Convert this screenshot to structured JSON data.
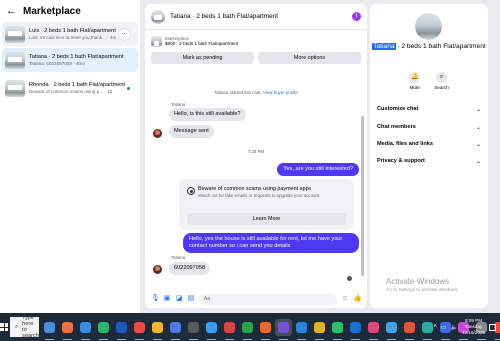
{
  "left_panel": {
    "back_icon": "arrow-left-icon",
    "title": "Marketplace",
    "conversations": [
      {
        "name": "Luis · 2 beds 1 bath Flat/apartment",
        "preview": "Luis: Im cuis nice to meet you thank... · 4m",
        "more_label": "…"
      },
      {
        "name": "Tatiana · 2 beds 1 bath Flat/apartment",
        "preview": "Tatiana: 6022097058 · 40m"
      },
      {
        "name": "Rhonda · 2 beds 1 bath Flat/apartment",
        "preview": "Beware of common scams using p... · 1d"
      }
    ]
  },
  "chat": {
    "title": "Tatiana · 2 beds 1 bath Flat/apartment",
    "info_icon": "i",
    "listing_label": "Marketplace",
    "listing_detail": "$800 · 2 beds 1 bath Flat/apartment",
    "mark_pending": "Mark as pending",
    "more_options": "More options",
    "started_text": "Tatiana started this chat.",
    "view_profile": "View buyer profile",
    "sender_name_1": "Tatiana",
    "msg_1": "Hello, is this still available?",
    "msg_2": "Message sent",
    "timestamp": "7:28 PM",
    "msg_3": "Yes, are you still interested?",
    "scam_title": "Beware of common scams using payment apps",
    "scam_body": "Watch out for fake emails or requests to upgrade your account.",
    "learn_more": "Learn More",
    "msg_4": "Hello, yes the house is still available for rent, let me have your contact number so i can send you details",
    "sender_name_2": "Tatiana",
    "msg_5": "6022097058",
    "composer_placeholder": "Aa"
  },
  "right_panel": {
    "title_highlight": "Tatiana",
    "title_rest": " · 2 beds 1 bath Flat/apartment",
    "mute_label": "Mute",
    "search_label": "Search",
    "sections": [
      "Customize chat",
      "Chat members",
      "Media, files and links",
      "Privacy & support"
    ]
  },
  "watermark": {
    "line1": "Activate Windows",
    "line2": "Go to Settings to activate Windows."
  },
  "taskbar": {
    "search_placeholder": "Type here to search",
    "time": "8:09 PM",
    "day": "Tuesday",
    "date": "12/16/2025",
    "pinned_colors": [
      "#4a90d9",
      "#e8734a",
      "#3c8dde",
      "#2fb36b",
      "#1e5bb8",
      "#e84a4a",
      "#f2b233",
      "#4a7be8",
      "#5a5a5a",
      "#3b9ded",
      "#d64545",
      "#2aa44f",
      "#e86a2a",
      "#7a52d6",
      "#2b84d8",
      "#e1b12c",
      "#2fbf71",
      "#1f6fd1",
      "#d94b7a",
      "#4aa0e8",
      "#e0563a",
      "#2fa8a0",
      "#3d6be0",
      "#c44ad9",
      "#8a8a8a",
      "#e84a4a",
      "#33a36a"
    ]
  },
  "colors": {
    "accent": "#1877f2",
    "outgoing_bubble": "#4e39f2",
    "info_button": "#a335ff",
    "selected_conversation": "#e4effd"
  }
}
